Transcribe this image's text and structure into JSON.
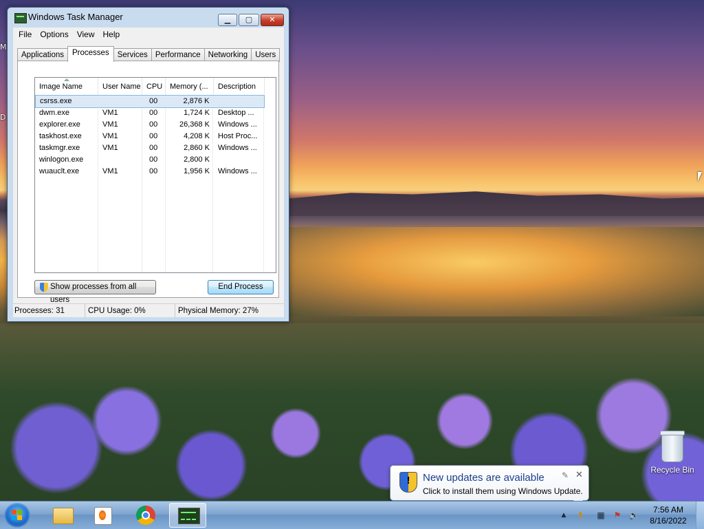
{
  "window": {
    "title": "Windows Task Manager",
    "controls": {
      "minimize": "▁",
      "maximize": "▢",
      "close": "✕"
    }
  },
  "menu": [
    "File",
    "Options",
    "View",
    "Help"
  ],
  "tabs": [
    "Applications",
    "Processes",
    "Services",
    "Performance",
    "Networking",
    "Users"
  ],
  "active_tab": "Processes",
  "processes": {
    "columns": [
      "Image Name",
      "User Name",
      "CPU",
      "Memory (...",
      "Description"
    ],
    "rows": [
      {
        "name": "csrss.exe",
        "user": "",
        "cpu": "00",
        "memory": "2,876 K",
        "description": ""
      },
      {
        "name": "dwm.exe",
        "user": "VM1",
        "cpu": "00",
        "memory": "1,724 K",
        "description": "Desktop ..."
      },
      {
        "name": "explorer.exe",
        "user": "VM1",
        "cpu": "00",
        "memory": "26,368 K",
        "description": "Windows ..."
      },
      {
        "name": "taskhost.exe",
        "user": "VM1",
        "cpu": "00",
        "memory": "4,208 K",
        "description": "Host Proc..."
      },
      {
        "name": "taskmgr.exe",
        "user": "VM1",
        "cpu": "00",
        "memory": "2,860 K",
        "description": "Windows ..."
      },
      {
        "name": "winlogon.exe",
        "user": "",
        "cpu": "00",
        "memory": "2,800 K",
        "description": ""
      },
      {
        "name": "wuauclt.exe",
        "user": "VM1",
        "cpu": "00",
        "memory": "1,956 K",
        "description": "Windows ..."
      }
    ],
    "selected_row": 0,
    "show_all_label": "Show processes from all users",
    "end_process_label": "End Process"
  },
  "status": {
    "processes": "Processes: 31",
    "cpu": "CPU Usage: 0%",
    "memory": "Physical Memory: 27%"
  },
  "desktop": {
    "recycle_bin": "Recycle Bin",
    "edge_glyphs": [
      "M",
      "D"
    ]
  },
  "notification": {
    "title": "New updates are available",
    "text": "Click to install them using Windows Update.",
    "icon": "shield-warning-icon"
  },
  "taskbar": {
    "items": [
      "start-orb",
      "windows-explorer",
      "windows-media-player",
      "google-chrome",
      "task-manager"
    ],
    "active": "task-manager",
    "tray_icons": [
      "show-hidden-icons-arrow",
      "windows-update-icon",
      "network-icon",
      "action-center-flag-icon",
      "volume-icon"
    ],
    "tray_glyphs": {
      "arrow": "▲",
      "update": "⬆",
      "network": "▦",
      "flag": "⚑",
      "volume": "🔈"
    },
    "time": "7:56 AM",
    "date": "8/16/2022"
  }
}
